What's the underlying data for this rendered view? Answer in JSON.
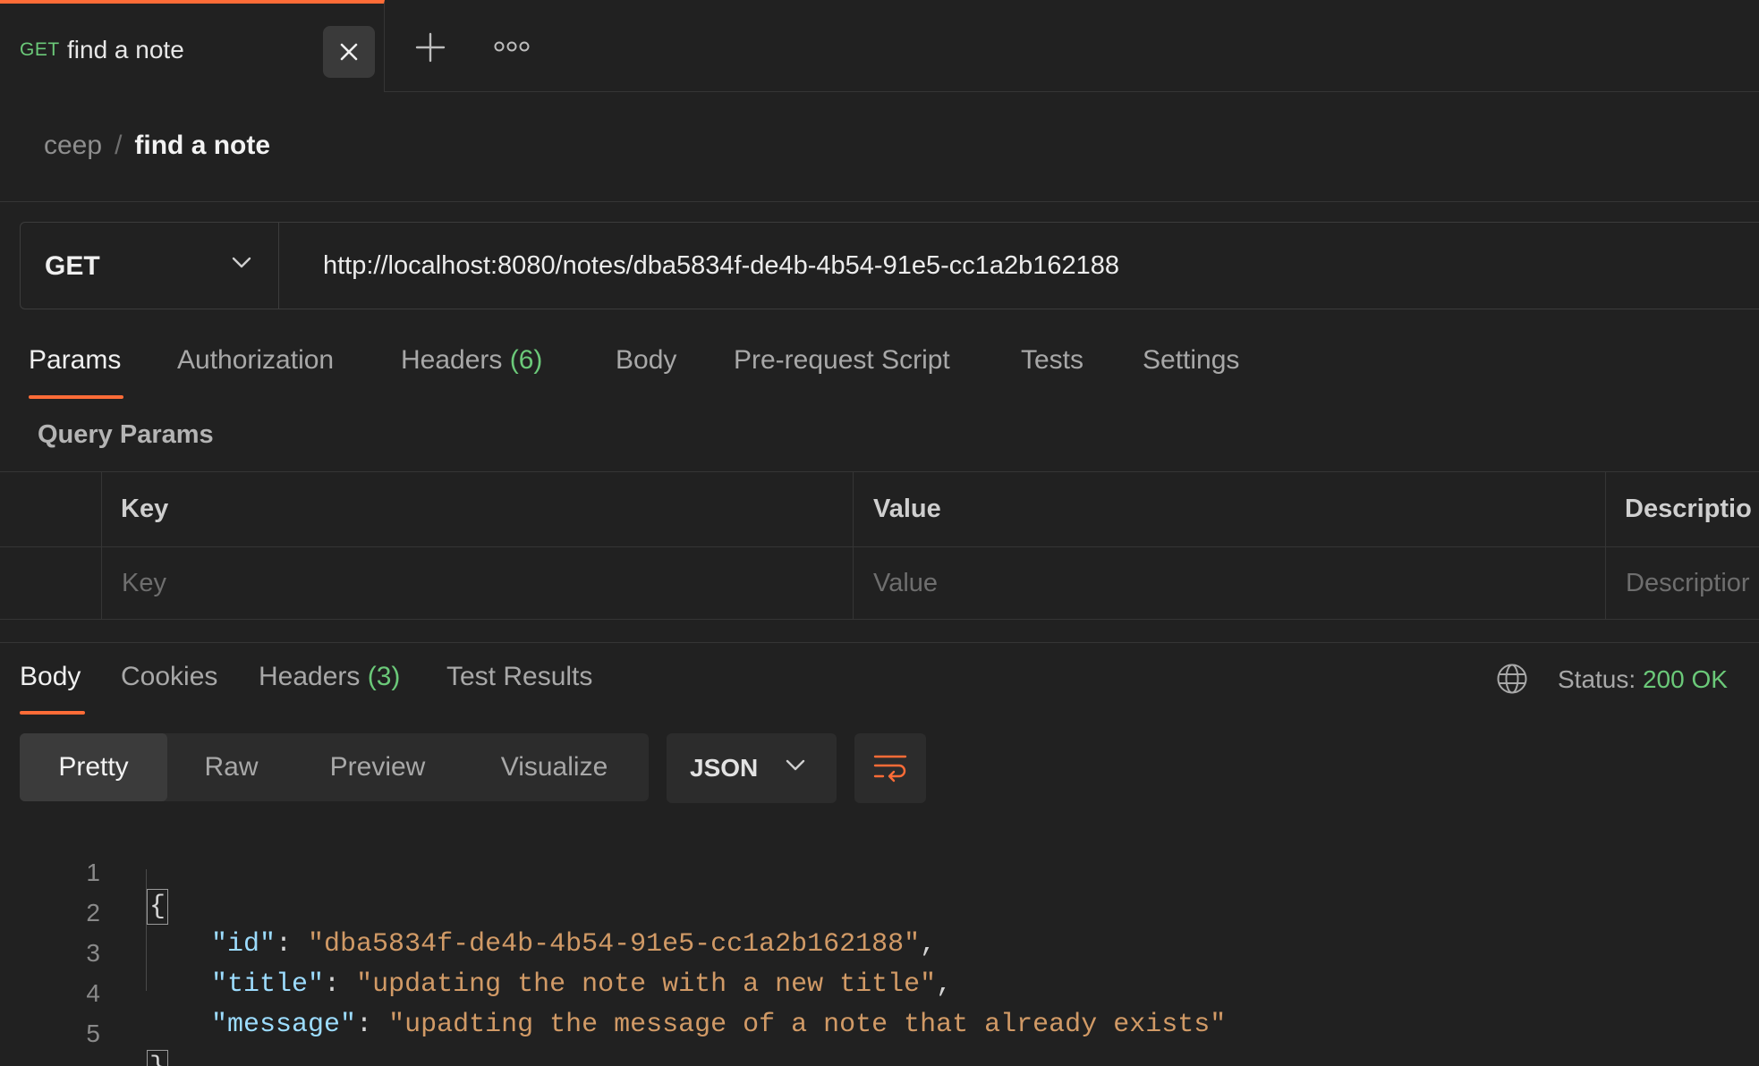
{
  "tab": {
    "method": "GET",
    "title": "find a note"
  },
  "breadcrumb": {
    "parent": "ceep",
    "separator": "/",
    "current": "find a note"
  },
  "request": {
    "method": "GET",
    "url": "http://localhost:8080/notes/dba5834f-de4b-4b54-91e5-cc1a2b162188",
    "tabs": [
      {
        "label": "Params"
      },
      {
        "label": "Authorization"
      },
      {
        "label": "Headers",
        "count": "(6)"
      },
      {
        "label": "Body"
      },
      {
        "label": "Pre-request Script"
      },
      {
        "label": "Tests"
      },
      {
        "label": "Settings"
      }
    ],
    "query_params_title": "Query Params",
    "table": {
      "headers": [
        "Key",
        "Value",
        "Descriptio"
      ],
      "placeholders": [
        "Key",
        "Value",
        "Descriptior"
      ]
    }
  },
  "response": {
    "tabs": [
      {
        "label": "Body"
      },
      {
        "label": "Cookies"
      },
      {
        "label": "Headers",
        "count": "(3)"
      },
      {
        "label": "Test Results"
      }
    ],
    "status_label": "Status:",
    "status_value": "200 OK",
    "views": [
      "Pretty",
      "Raw",
      "Preview",
      "Visualize"
    ],
    "format": "JSON",
    "lines": [
      "1",
      "2",
      "3",
      "4",
      "5"
    ],
    "json": {
      "open": "{",
      "close": "}",
      "fields": [
        {
          "key": "\"id\"",
          "value": "\"dba5834f-de4b-4b54-91e5-cc1a2b162188\"",
          "trail": ","
        },
        {
          "key": "\"title\"",
          "value": "\"updating the note with a new title\"",
          "trail": ","
        },
        {
          "key": "\"message\"",
          "value": "\"upadting the message of a note that already exists\"",
          "trail": ""
        }
      ]
    }
  },
  "colors": {
    "accent": "#ff6c37",
    "method_green": "#6bc979",
    "json_key": "#9cdcfe",
    "json_string": "#d19a66"
  }
}
